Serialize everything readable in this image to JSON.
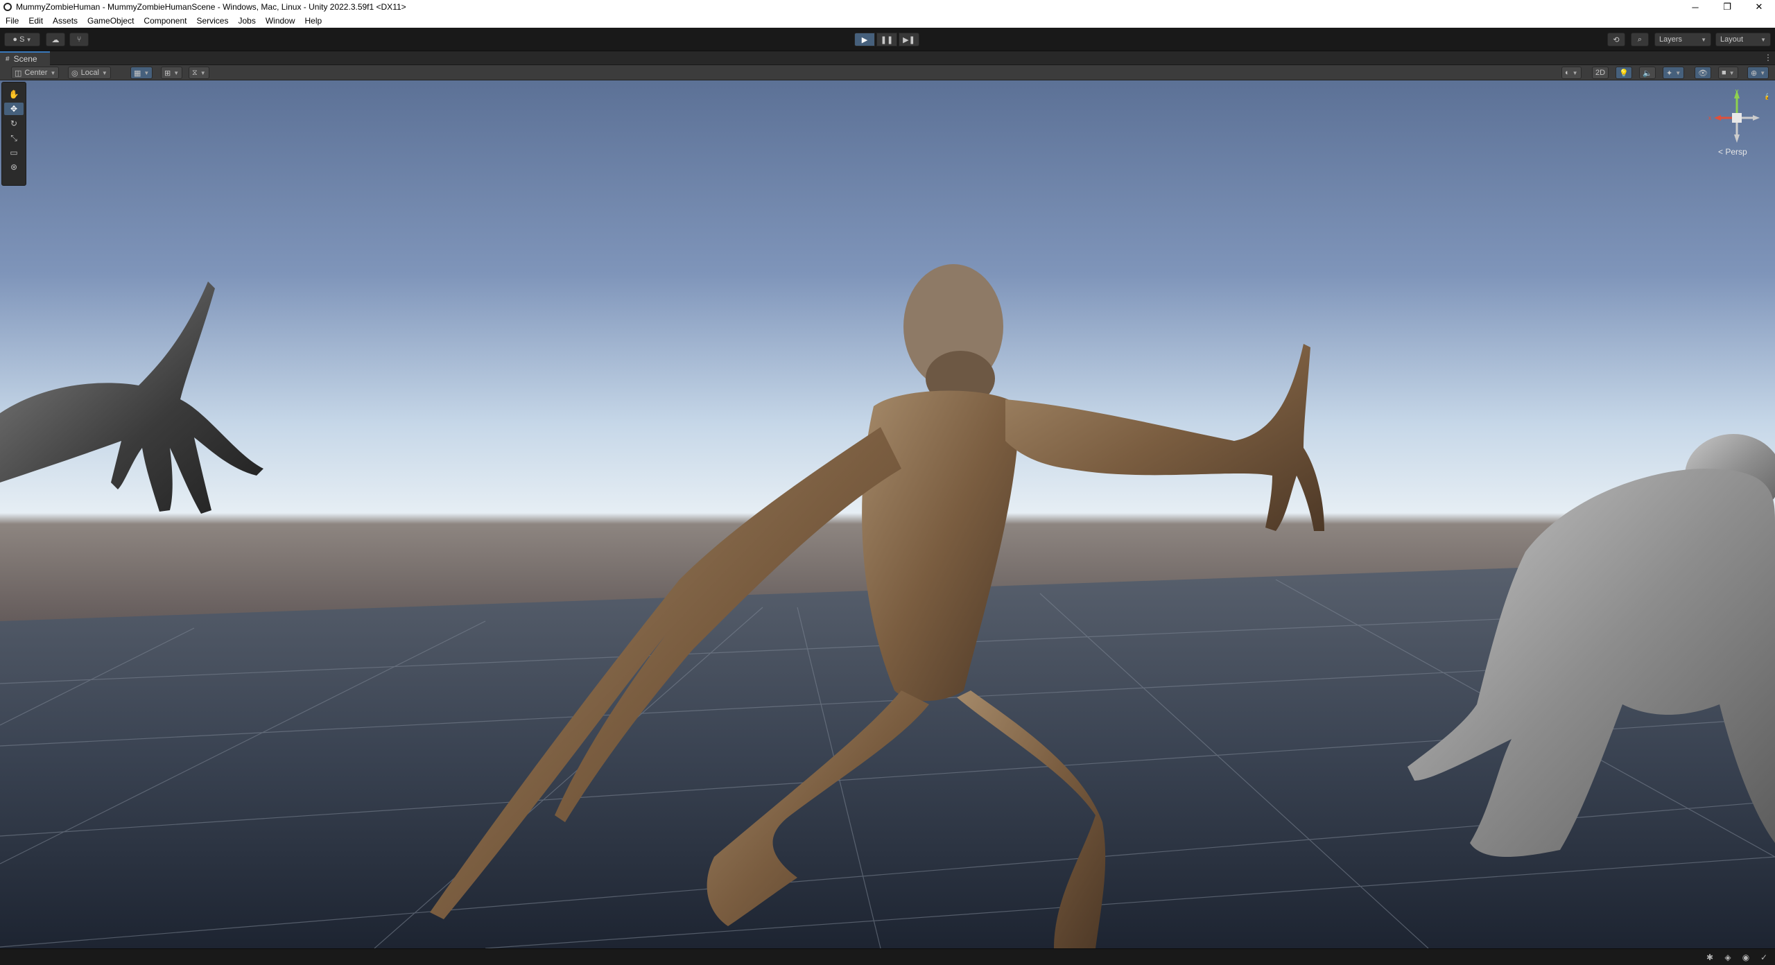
{
  "window": {
    "title": "MummyZombieHuman - MummyZombieHumanScene - Windows, Mac, Linux - Unity 2022.3.59f1 <DX11>",
    "controls": {
      "minimize": "─",
      "maximize": "❐",
      "close": "✕"
    }
  },
  "menu": {
    "items": [
      "File",
      "Edit",
      "Assets",
      "GameObject",
      "Component",
      "Services",
      "Jobs",
      "Window",
      "Help"
    ]
  },
  "toolbar": {
    "account_label": "S",
    "play_icon": "play-icon",
    "pause_icon": "pause-icon",
    "step_icon": "step-icon",
    "layers_label": "Layers",
    "layout_label": "Layout"
  },
  "scene_tab": {
    "label": "Scene"
  },
  "scene_toolbar": {
    "pivot_mode": "Center",
    "pivot_rotation": "Local",
    "toggle_2d": "2D"
  },
  "gizmo": {
    "projection_label": "< Persp",
    "axes": {
      "y": "y",
      "x": "x"
    }
  },
  "colors": {
    "accent": "#46607c",
    "tab_highlight": "#3a79bb",
    "editor_bg": "#191919"
  }
}
